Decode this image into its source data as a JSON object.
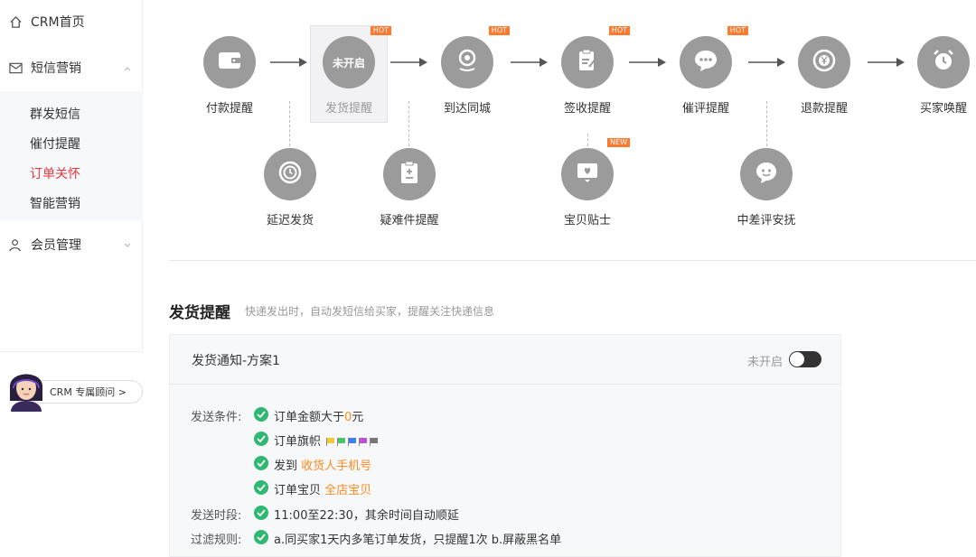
{
  "sidebar": {
    "home": "CRM首页",
    "sms": "短信营销",
    "sub_items": [
      "群发短信",
      "催付提醒",
      "订单关怀",
      "智能营销"
    ],
    "member": "会员管理",
    "advisor_label": "CRM 专属顾问 >"
  },
  "flow": {
    "top_steps": [
      {
        "label": "付款提醒",
        "icon": "wallet-icon"
      },
      {
        "label": "发货提醒",
        "icon": "text",
        "text": "未开启",
        "badge": "HOT"
      },
      {
        "label": "到达同城",
        "icon": "location-pin-icon",
        "badge": "HOT"
      },
      {
        "label": "签收提醒",
        "icon": "sign-icon",
        "badge": "HOT"
      },
      {
        "label": "催评提醒",
        "icon": "chat-bubble-icon",
        "badge": "HOT"
      },
      {
        "label": "退款提醒",
        "icon": "yen-icon"
      },
      {
        "label": "买家唤醒",
        "icon": "alarm-clock-icon"
      }
    ],
    "bottom_steps": [
      {
        "label": "延迟发货",
        "icon": "clock-icon"
      },
      {
        "label": "疑难件提醒",
        "icon": "clipboard-icon"
      },
      {
        "label": "宝贝贴士",
        "icon": "heart-card-icon",
        "badge": "NEW"
      },
      {
        "label": "中差评安抚",
        "icon": "smile-icon"
      }
    ]
  },
  "detail": {
    "title": "发货提醒",
    "desc": "快递发出时，自动发短信给买家，提醒关注快递信息",
    "plan_title": "发货通知-方案1",
    "status": "未开启",
    "cond_label": "发送条件:",
    "cond1_pre": "订单金额大于",
    "cond1_val": "0",
    "cond1_post": "元",
    "cond2": "订单旗帜",
    "flag_colors": [
      "#f5c842",
      "#4cc46a",
      "#3b82f6",
      "#c04fd8",
      "#777777"
    ],
    "cond3_pre": "发到",
    "cond3_val": "收货人手机号",
    "cond4_pre": "订单宝贝",
    "cond4_val": "全店宝贝",
    "time_label": "发送时段:",
    "time_text": "11:00至22:30，其余时间自动顺延",
    "filter_label": "过滤规则:",
    "filter_text": "a.同买家1天内多笔订单发货，只提醒1次   b.屏蔽黑名单"
  },
  "colors": {
    "accent_red": "#e4393c",
    "orange": "#ff8a1f",
    "check_green": "#2eb872",
    "icon_gray": "#9b9b9b"
  }
}
